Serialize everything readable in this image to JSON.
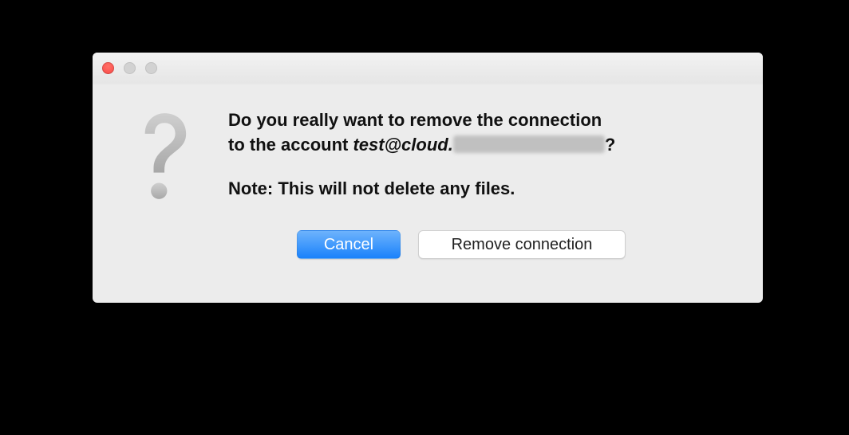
{
  "dialog": {
    "headline_prefix": "Do you really want to remove the connection",
    "headline_line2_prefix": "to the account ",
    "account": "test@cloud.",
    "headline_suffix": "?",
    "note": "Note: This will not delete any files.",
    "buttons": {
      "cancel": "Cancel",
      "confirm": "Remove connection"
    }
  }
}
